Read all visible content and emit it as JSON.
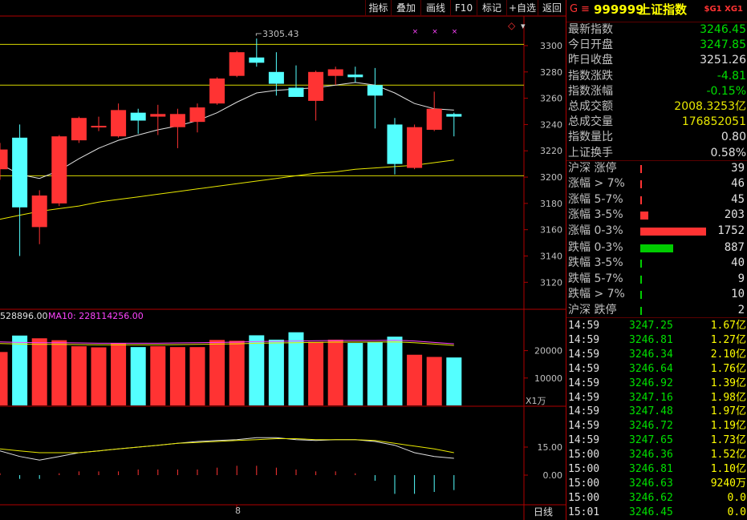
{
  "toolbar": {
    "buttons": [
      "指标",
      "叠加",
      "画线",
      "F10",
      "标记",
      "+自选",
      "返回"
    ]
  },
  "header": {
    "code": "999999",
    "name": "上证指数",
    "tag": "$G1 XG1",
    "marker": "G"
  },
  "quote": [
    {
      "label": "最新指数",
      "value": "3246.45",
      "color": "#00e000"
    },
    {
      "label": "今日开盘",
      "value": "3247.85",
      "color": "#00e000"
    },
    {
      "label": "昨日收盘",
      "value": "3251.26",
      "color": "#e0e0e0"
    },
    {
      "label": "指数涨跌",
      "value": "-4.81",
      "color": "#00e000"
    },
    {
      "label": "指数涨幅",
      "value": "-0.15%",
      "color": "#00e000"
    },
    {
      "label": "总成交额",
      "value": "2008.3253亿",
      "color": "#e8e800"
    },
    {
      "label": "总成交量",
      "value": "176852051",
      "color": "#e8e800"
    },
    {
      "label": "指数量比",
      "value": "0.80",
      "color": "#e0e0e0"
    },
    {
      "label": "上证换手",
      "value": "0.58%",
      "color": "#e0e0e0"
    }
  ],
  "distribution": [
    {
      "label": "沪深 涨停",
      "count": "39",
      "bar": 0.02,
      "color": "#ff3333"
    },
    {
      "label": "涨幅 > 7%",
      "count": "46",
      "bar": 0.026,
      "color": "#ff3333"
    },
    {
      "label": "涨幅 5-7%",
      "count": "45",
      "bar": 0.026,
      "color": "#ff3333"
    },
    {
      "label": "涨幅 3-5%",
      "count": "203",
      "bar": 0.116,
      "color": "#ff3333"
    },
    {
      "label": "涨幅 0-3%",
      "count": "1752",
      "bar": 1.0,
      "color": "#ff3333"
    },
    {
      "label": "跌幅 0-3%",
      "count": "887",
      "bar": 0.506,
      "color": "#00cc00"
    },
    {
      "label": "跌幅 3-5%",
      "count": "40",
      "bar": 0.023,
      "color": "#00cc00"
    },
    {
      "label": "跌幅 5-7%",
      "count": "9",
      "bar": 0.008,
      "color": "#00cc00"
    },
    {
      "label": "跌幅 > 7%",
      "count": "10",
      "bar": 0.008,
      "color": "#00cc00"
    },
    {
      "label": "沪深 跌停",
      "count": "2",
      "bar": 0.004,
      "color": "#00cc00"
    }
  ],
  "ticks": [
    {
      "time": "14:59",
      "price": "3247.25",
      "amount": "1.67亿"
    },
    {
      "time": "14:59",
      "price": "3246.81",
      "amount": "1.27亿"
    },
    {
      "time": "14:59",
      "price": "3246.34",
      "amount": "2.10亿"
    },
    {
      "time": "14:59",
      "price": "3246.64",
      "amount": "1.76亿"
    },
    {
      "time": "14:59",
      "price": "3246.92",
      "amount": "1.39亿"
    },
    {
      "time": "14:59",
      "price": "3247.16",
      "amount": "1.98亿"
    },
    {
      "time": "14:59",
      "price": "3247.48",
      "amount": "1.97亿"
    },
    {
      "time": "14:59",
      "price": "3246.72",
      "amount": "1.19亿"
    },
    {
      "time": "14:59",
      "price": "3247.65",
      "amount": "1.73亿"
    },
    {
      "time": "15:00",
      "price": "3246.36",
      "amount": "1.52亿"
    },
    {
      "time": "15:00",
      "price": "3246.81",
      "amount": "1.10亿"
    },
    {
      "time": "15:00",
      "price": "3246.63",
      "amount": "9240万"
    },
    {
      "time": "15:00",
      "price": "3246.62",
      "amount": "0.0"
    },
    {
      "time": "15:01",
      "price": "3246.45",
      "amount": "0.0"
    }
  ],
  "chart_data": {
    "type": "candlestick",
    "price_axis": {
      "ticks": [
        3120,
        3140,
        3160,
        3180,
        3200,
        3220,
        3240,
        3260,
        3280,
        3300
      ],
      "range": [
        3108,
        3314
      ]
    },
    "high_label": "3305.43",
    "hlines": [
      3301,
      3270,
      3201
    ],
    "candles": [
      {
        "o": 3206,
        "c": 3221,
        "h": 3226,
        "l": 3198,
        "up": true
      },
      {
        "o": 3230,
        "c": 3177,
        "h": 3240,
        "l": 3140,
        "up": false
      },
      {
        "o": 3162,
        "c": 3186,
        "h": 3190,
        "l": 3149,
        "up": true
      },
      {
        "o": 3180,
        "c": 3231,
        "h": 3232,
        "l": 3178,
        "up": true
      },
      {
        "o": 3228,
        "c": 3245,
        "h": 3246,
        "l": 3226,
        "up": true
      },
      {
        "o": 3238,
        "c": 3239,
        "h": 3246,
        "l": 3235,
        "up": true
      },
      {
        "o": 3231,
        "c": 3251,
        "h": 3256,
        "l": 3230,
        "up": true
      },
      {
        "o": 3249,
        "c": 3243,
        "h": 3252,
        "l": 3233,
        "up": false
      },
      {
        "o": 3246,
        "c": 3248,
        "h": 3255,
        "l": 3232,
        "up": true
      },
      {
        "o": 3238,
        "c": 3248,
        "h": 3252,
        "l": 3222,
        "up": true
      },
      {
        "o": 3242,
        "c": 3253,
        "h": 3256,
        "l": 3234,
        "up": true
      },
      {
        "o": 3256,
        "c": 3275,
        "h": 3276,
        "l": 3255,
        "up": true
      },
      {
        "o": 3277,
        "c": 3295,
        "h": 3296,
        "l": 3276,
        "up": true
      },
      {
        "o": 3291,
        "c": 3287,
        "h": 3305.43,
        "l": 3284,
        "up": false
      },
      {
        "o": 3280,
        "c": 3271,
        "h": 3295,
        "l": 3262,
        "up": false
      },
      {
        "o": 3268,
        "c": 3261,
        "h": 3285,
        "l": 3261,
        "up": false
      },
      {
        "o": 3258,
        "c": 3280,
        "h": 3281,
        "l": 3243,
        "up": true
      },
      {
        "o": 3277,
        "c": 3282,
        "h": 3284,
        "l": 3270,
        "up": true
      },
      {
        "o": 3278,
        "c": 3276,
        "h": 3284,
        "l": 3272,
        "up": false
      },
      {
        "o": 3270,
        "c": 3262,
        "h": 3283,
        "l": 3237,
        "up": false
      },
      {
        "o": 3240,
        "c": 3210,
        "h": 3245,
        "l": 3202,
        "up": false
      },
      {
        "o": 3207,
        "c": 3238,
        "h": 3240,
        "l": 3206,
        "up": true
      },
      {
        "o": 3236,
        "c": 3252,
        "h": 3265,
        "l": 3235,
        "up": true
      },
      {
        "o": 3248,
        "c": 3246,
        "h": 3249,
        "l": 3231,
        "up": false
      }
    ],
    "ma_short": [
      3210,
      3202,
      3199,
      3205,
      3214,
      3222,
      3228,
      3232,
      3236,
      3239,
      3243,
      3249,
      3257,
      3264,
      3266,
      3267,
      3268,
      3270,
      3272,
      3270,
      3264,
      3256,
      3252,
      3251
    ],
    "ma_long": [
      3168,
      3171,
      3174,
      3176,
      3178,
      3181,
      3183,
      3185,
      3187,
      3189,
      3191,
      3193,
      3195,
      3197,
      3199,
      3201,
      3203,
      3204,
      3206,
      3207,
      3208,
      3209,
      3211,
      3213
    ],
    "volume": {
      "legend_left": "528896.00",
      "legend_ma10": "MA10: 228114256.00",
      "ticks": [
        10000,
        20000
      ],
      "unit": "X1万",
      "bars": [
        19500,
        25500,
        24500,
        23800,
        21600,
        21200,
        22800,
        21300,
        21600,
        21300,
        21300,
        23900,
        23600,
        25600,
        24000,
        26700,
        23200,
        24000,
        22800,
        23100,
        25100,
        18500,
        17700,
        17500
      ],
      "ma": [
        23200,
        23000,
        22900,
        22900,
        22800,
        22700,
        22700,
        22700,
        22700,
        22800,
        22900,
        23000,
        23100,
        23300,
        23400,
        23500,
        23600,
        23700,
        23700,
        23700,
        23800,
        23500,
        23000,
        22500
      ]
    },
    "indicator": {
      "ticks": [
        0,
        15
      ],
      "line1": [
        13,
        10,
        8,
        10,
        12,
        13,
        14,
        15,
        16,
        17,
        18,
        18.5,
        19,
        20,
        20,
        19,
        18.5,
        19,
        19,
        18,
        16,
        12,
        10,
        9
      ],
      "line2": [
        14,
        13,
        12,
        12,
        12,
        13,
        14,
        15,
        16,
        17,
        17.5,
        18,
        18.5,
        19,
        19.5,
        19.5,
        19,
        19,
        19,
        18.5,
        17,
        15.5,
        14,
        12
      ],
      "hist": [
        1,
        -2,
        -2,
        1,
        2,
        2,
        2,
        3,
        3,
        3,
        3,
        4,
        5,
        5,
        4,
        3,
        2,
        2,
        1,
        -3,
        -10,
        -10,
        -9,
        -8
      ]
    },
    "x_label": "8",
    "period_label": "日线"
  }
}
